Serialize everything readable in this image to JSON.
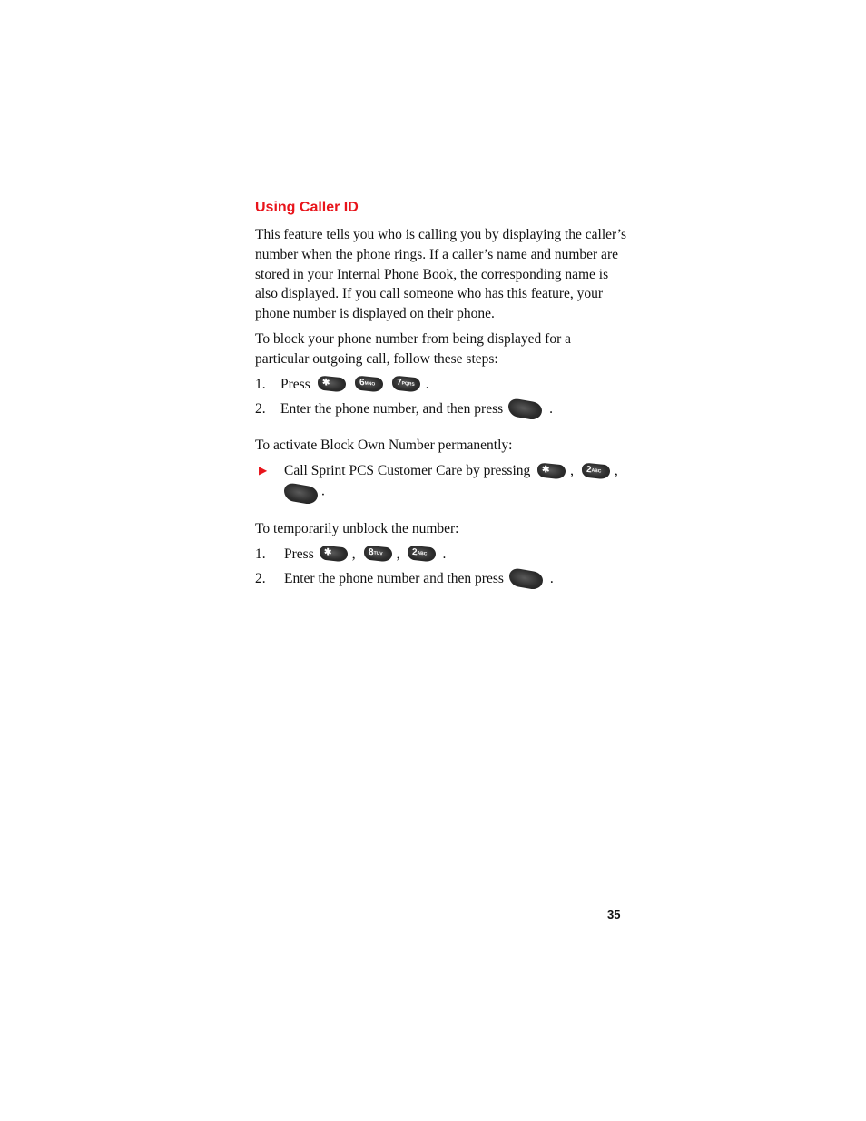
{
  "section": {
    "title": "Using Caller ID",
    "intro": "This feature tells you who is calling you by displaying the caller’s number when the phone rings. If a caller’s name and number are stored in your Internal Phone Book, the corresponding name is also displayed. If you call someone who has this feature, your phone number is displayed on their phone.",
    "block_intro": "To block your phone number from being displayed for a particular outgoing call, follow these steps:",
    "block_steps": [
      {
        "num": "1.",
        "text": "Press",
        "keys": [
          "*",
          "6 MNO",
          "7 PQRS"
        ]
      },
      {
        "num": "2.",
        "text": "Enter the phone number, and then press",
        "keys": [
          "talk"
        ]
      }
    ],
    "permanent_intro": "To activate Block Own Number permanently:",
    "permanent_bullet": {
      "text": "Call Sprint PCS Customer Care by pressing",
      "keys": [
        "*",
        "2 ABC",
        "talk"
      ]
    },
    "unblock_intro": "To temporarily unblock the number:",
    "unblock_steps": [
      {
        "num": "1.",
        "text": "Press",
        "keys": [
          "*",
          "8 TUV",
          "2 ABC"
        ]
      },
      {
        "num": "2.",
        "text": "Enter the phone number and then press",
        "keys": [
          "talk"
        ]
      }
    ]
  },
  "keys": {
    "star": "✱",
    "six": "6",
    "six_sub": "MNO",
    "seven": "7",
    "seven_sub": "PQRS",
    "two": "2",
    "two_sub": "ABC",
    "eight": "8",
    "eight_sub": "TUV"
  },
  "punct": {
    "period": ".",
    "comma": ","
  },
  "bullet_icon": "▶",
  "page_number": "35",
  "colors": {
    "heading": "#e8141b",
    "bullet": "#e8141b",
    "key": "#2e2e2e"
  }
}
